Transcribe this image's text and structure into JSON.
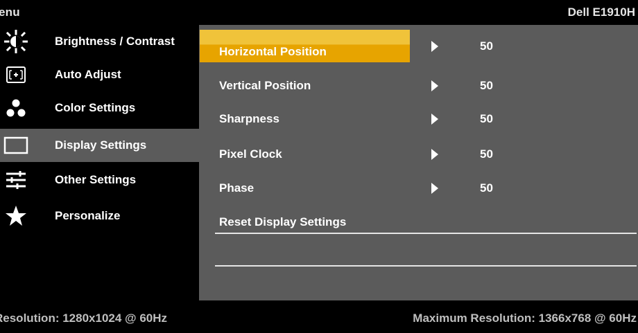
{
  "header": {
    "title": "enu",
    "model": "Dell E1910H"
  },
  "sidebar": {
    "items": [
      {
        "label": "Brightness / Contrast",
        "icon": "sun-icon"
      },
      {
        "label": "Auto Adjust",
        "icon": "auto-adjust-icon"
      },
      {
        "label": "Color Settings",
        "icon": "color-dots-icon"
      },
      {
        "label": "Display Settings",
        "icon": "monitor-icon"
      },
      {
        "label": "Other Settings",
        "icon": "sliders-icon"
      },
      {
        "label": "Personalize",
        "icon": "star-icon"
      }
    ],
    "selected": "Display Settings"
  },
  "content": {
    "rows": [
      {
        "label": "Horizontal Position",
        "value": "50"
      },
      {
        "label": "Vertical Position",
        "value": "50"
      },
      {
        "label": "Sharpness",
        "value": "50"
      },
      {
        "label": "Pixel Clock",
        "value": "50"
      },
      {
        "label": "Phase",
        "value": "50"
      },
      {
        "label": "Reset Display Settings"
      }
    ],
    "highlighted": "Horizontal Position"
  },
  "footer": {
    "resolution": "Resolution: 1280x1024 @ 60Hz",
    "max_resolution": "Maximum Resolution: 1366x768 @ 60Hz"
  },
  "colors": {
    "highlight_top": "#f0c33a",
    "highlight_bottom": "#e7a400",
    "panel": "#5b5b5b",
    "background": "#000000"
  }
}
